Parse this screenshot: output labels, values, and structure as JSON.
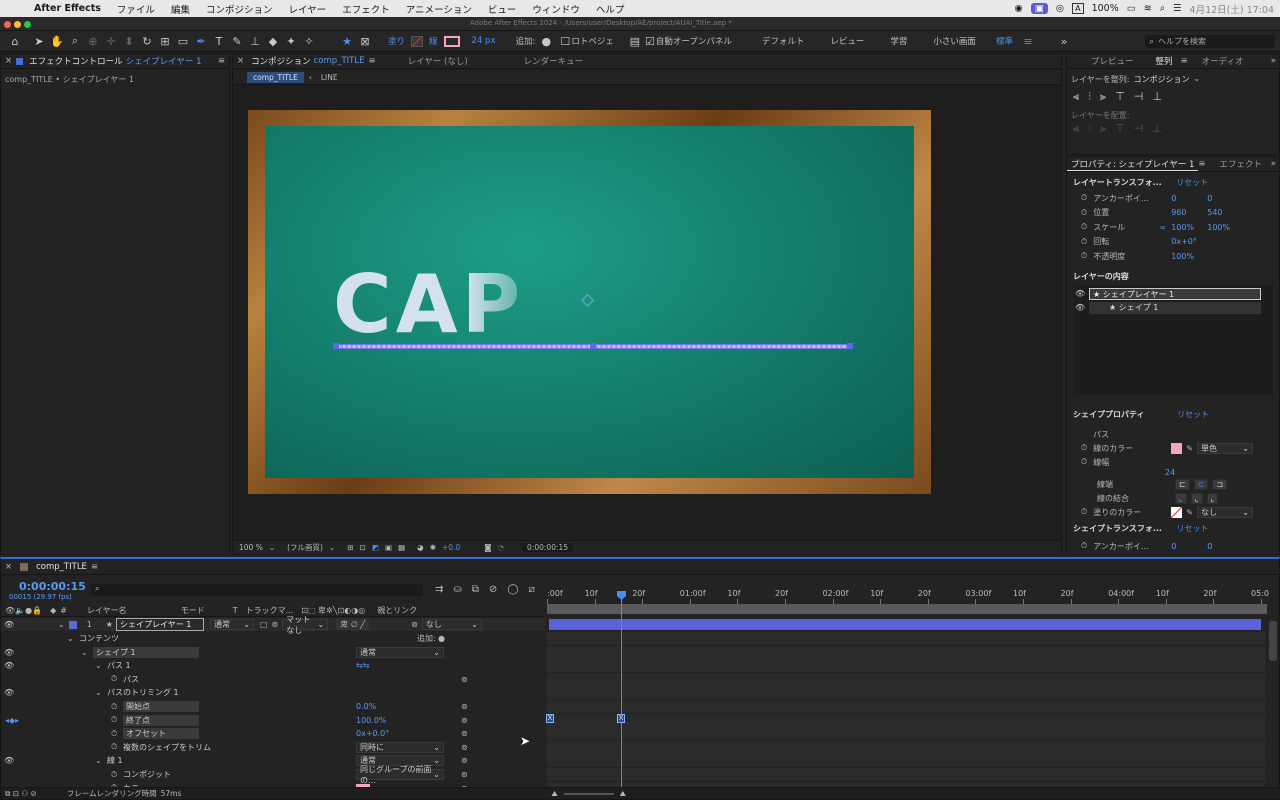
{
  "menubar": {
    "app": "After Effects",
    "items": [
      "ファイル",
      "編集",
      "コンポジション",
      "レイヤー",
      "エフェクト",
      "アニメーション",
      "ビュー",
      "ウィンドウ",
      "ヘルプ"
    ],
    "input_mode": "A",
    "battery": "100%",
    "clock": "4月12日(土) 17:04"
  },
  "window": {
    "title": "Adobe After Effects 2024 - /Users/user/Desktop/AE/project/AUAI_Title.aep *"
  },
  "toolbar": {
    "fill_label": "塗り",
    "stroke_label": "線",
    "stroke_width": "24 px",
    "add_label": "追加:",
    "bezier_label": "ロトベジェ",
    "auto_open_label": "自動オープンパネル",
    "workspaces": [
      "デフォルト",
      "レビュー",
      "学習",
      "小さい画面",
      "標準"
    ],
    "search_placeholder": "ヘルプを検索",
    "stroke_color": "#f4a6c8"
  },
  "effects_panel": {
    "title": "エフェクトコントロール",
    "layer": "シェイプレイヤー 1",
    "breadcrumb": "comp_TITLE • シェイプレイヤー 1"
  },
  "comp_panel": {
    "tab_title": "コンポジション",
    "comp_name": "comp_TITLE",
    "layer_tab": "レイヤー (なし)",
    "render_tab": "レンダーキュー",
    "nav_comp": "comp_TITLE",
    "nav_line": "LINE",
    "chalk_text": "CAP",
    "zoom": "100 %",
    "quality": "(フル画質)",
    "exposure": "+0.0",
    "timecode": "0:00:00:15"
  },
  "right_panel": {
    "tabs": [
      "プレビュー",
      "整列",
      "オーディオ"
    ],
    "align_to_label": "レイヤーを整列:",
    "align_to_value": "コンポジション",
    "distribute_label": "レイヤーを配置:"
  },
  "properties": {
    "tab_title": "プロパティ: シェイプレイヤー 1",
    "effects_tab": "エフェクト",
    "transform_title": "レイヤートランスフォ...",
    "reset": "リセット",
    "transform": [
      {
        "label": "アンカーポイ...",
        "v1": "0",
        "v2": "0"
      },
      {
        "label": "位置",
        "v1": "960",
        "v2": "540"
      },
      {
        "label": "スケール",
        "v1": "100%",
        "v2": "100%"
      },
      {
        "label": "回転",
        "v1": "0x+0°",
        "v2": ""
      },
      {
        "label": "不透明度",
        "v1": "100%",
        "v2": ""
      }
    ],
    "contents_title": "レイヤーの内容",
    "contents": [
      "シェイプレイヤー 1",
      "シェイプ 1"
    ],
    "shape_props_title": "シェイププロパティ",
    "shape_props": {
      "path": "パス",
      "stroke_color_label": "線のカラー",
      "stroke_type": "単色",
      "stroke_width_label": "線幅",
      "stroke_width_value": "24",
      "line_cap": "線端",
      "line_join": "線の結合",
      "fill_color_label": "塗りのカラー",
      "fill_value": "なし"
    },
    "shape_transform_title": "シェイプトランスフォ...",
    "shape_anchor": {
      "label": "アンカーポイ...",
      "v1": "0",
      "v2": "0"
    }
  },
  "timeline": {
    "comp_name": "comp_TITLE",
    "timecode": "0:00:00:15",
    "frame_info": "00015 (29.97 fps)",
    "search_placeholder": "",
    "headers": {
      "layer_name": "レイヤー名",
      "mode": "モード",
      "t": "T",
      "track": "トラックマ...",
      "parent": "親とリンク"
    },
    "ruler": [
      ":00f",
      "10f",
      "20f",
      "01:00f",
      "10f",
      "20f",
      "02:00f",
      "10f",
      "20f",
      "03:00f",
      "10f",
      "20f",
      "04:00f",
      "10f",
      "20f",
      "05:0"
    ],
    "layer": {
      "num": "1",
      "name": "シェイプレイヤー 1",
      "mode": "通常",
      "track": "マットなし",
      "parent": "なし"
    },
    "rows": [
      {
        "indent": 1,
        "label": "コンテンツ",
        "value": "",
        "extra": "追加:"
      },
      {
        "indent": 2,
        "label": "シェイプ 1",
        "value": "通常"
      },
      {
        "indent": 3,
        "label": "パス 1",
        "value": ""
      },
      {
        "indent": 4,
        "label": "パス",
        "value": ""
      },
      {
        "indent": 3,
        "label": "パスのトリミング 1",
        "value": ""
      },
      {
        "indent": 4,
        "label": "開始点",
        "value": "0.0%"
      },
      {
        "indent": 4,
        "label": "終了点",
        "value": "100.0%"
      },
      {
        "indent": 4,
        "label": "オフセット",
        "value": "0x+0.0°"
      },
      {
        "indent": 4,
        "label": "複数のシェイプをトリム",
        "value": "同時に"
      },
      {
        "indent": 3,
        "label": "線 1",
        "value": "通常"
      },
      {
        "indent": 4,
        "label": "コンポジット",
        "value": "同じグループの前面の..."
      },
      {
        "indent": 4,
        "label": "カラー",
        "value": ""
      }
    ],
    "render_time_label": "フレームレンダリング時間",
    "render_time": "57ms"
  }
}
